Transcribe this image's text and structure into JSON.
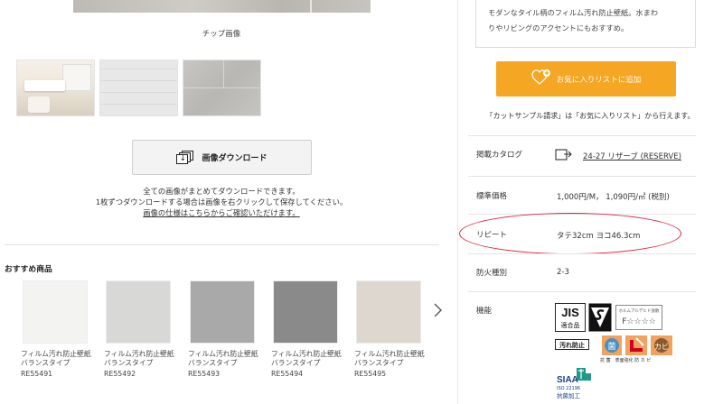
{
  "gallery": {
    "chip_caption": "チップ画像",
    "thumbnails": [
      "interior-photo",
      "wall-texture-light",
      "wall-texture-gray"
    ]
  },
  "download": {
    "button_label": "画像ダウンロード",
    "note_line1": "全ての画像がまとめてダウンロードできます。",
    "note_line2": "1枚ずつダウンロードする場合は画像を右クリックして保存してください。",
    "spec_link": "画像の仕様はこちらからご確認いただけます。"
  },
  "recommended": {
    "title": "おすすめ商品",
    "items": [
      {
        "name_line1": "フィルム汚れ防止壁紙",
        "name_line2": "バランスタイプ",
        "code": "RE55491",
        "color": "#f3f3f2"
      },
      {
        "name_line1": "フィルム汚れ防止壁紙",
        "name_line2": "バランスタイプ",
        "code": "RE55492",
        "color": "#d8d8d6"
      },
      {
        "name_line1": "フィルム汚れ防止壁紙",
        "name_line2": "バランスタイプ",
        "code": "RE55493",
        "color": "#a9a9a9"
      },
      {
        "name_line1": "フィルム汚れ防止壁紙",
        "name_line2": "バランスタイプ",
        "code": "RE55494",
        "color": "#8a8a8a"
      },
      {
        "name_line1": "フィルム汚れ防止壁紙",
        "name_line2": "バランスタイプ",
        "code": "RE55495",
        "color": "#ddd7cf"
      }
    ]
  },
  "product": {
    "desc_line1": "モダンなタイル柄のフィルム汚れ防止壁紙。水まわ",
    "desc_line2": "りやリビングのアクセントにもおすすめ。",
    "fav_button": "お気に入りリストに追加",
    "cut_note": "「カットサンプル請求」は「お気に入りリスト」から行えます。",
    "specs": {
      "catalog_label": "掲載カタログ",
      "catalog_value": "24-27 リザーブ (RESERVE)",
      "price_label": "標準価格",
      "price_value": "1,000円/M， 1,090円/㎡ (税別)",
      "repeat_label": "リピート",
      "repeat_value": "タテ32cm ヨコ46.3cm",
      "fire_label": "防火種別",
      "fire_value": "2-3",
      "function_label": "機能"
    },
    "badges": {
      "jis_top": "JIS",
      "jis_bottom": "適合品",
      "fstar": "F☆☆☆☆",
      "fstar_small": "ホルムアルデヒド放散",
      "stain": "汚れ防止",
      "func_labels": "抗 菌　表面強化 防 カ ビ",
      "siaa": "SIAA",
      "siaa_sub": "ISO 22196",
      "siaa_bottom": "抗菌加工"
    }
  },
  "colors": {
    "accent_orange": "#f5a623",
    "highlight_red": "#d7263d"
  }
}
